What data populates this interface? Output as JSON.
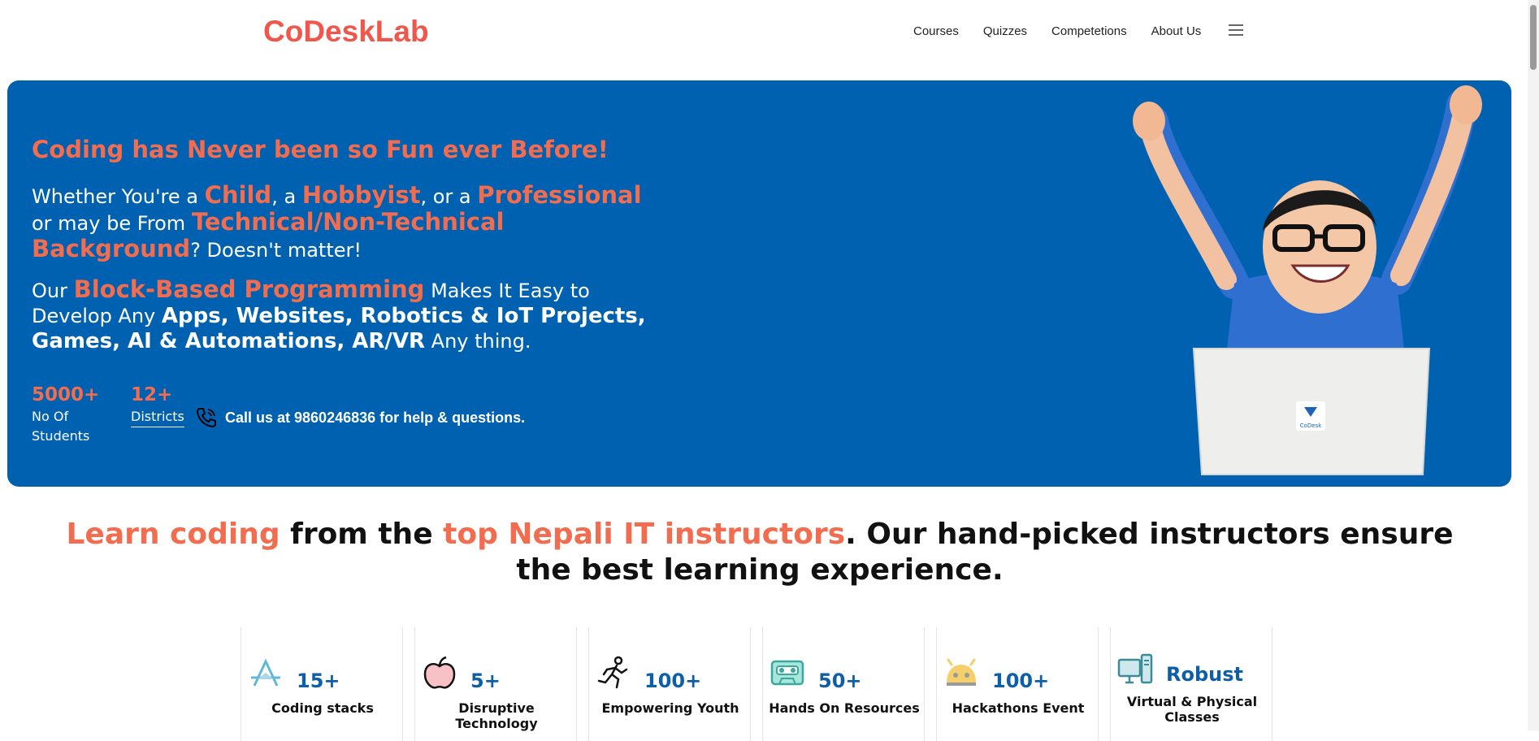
{
  "logo": "CoDeskLab",
  "nav": [
    "Courses",
    "Quizzes",
    "Competetions",
    "About Us"
  ],
  "hero": {
    "title": "Coding has Never been so Fun ever Before!",
    "p1": {
      "t1": "Whether You're a ",
      "h1": "Child",
      "t2": ", a ",
      "h2": "Hobbyist",
      "t3": ", or a ",
      "h3": "Professional",
      "t4": " or may be From ",
      "h4": "Technical/Non-Technical Background",
      "t5": "? Doesn't matter!"
    },
    "p2": {
      "t1": "Our ",
      "h1": "Block-Based Programming",
      "t2": " Makes It Easy to Develop Any ",
      "b1": "Apps, Websites, Robotics & IoT Projects, Games, AI & Automations, AR/VR",
      "t3": " Any thing."
    },
    "stats": [
      {
        "num": "5000+",
        "label_1": "No Of",
        "label_2": "Students"
      },
      {
        "num": "12+",
        "label_1": "Districts"
      }
    ],
    "call": "Call us at 9860246836 for help & questions.",
    "laptop_logo": "CoDesk"
  },
  "tagline": {
    "o1": "Learn coding",
    "t1": " from the ",
    "o2": "top Nepali IT instructors",
    "t2": ". Our hand-picked instructors ensure the best learning experience."
  },
  "features": [
    {
      "num": "15+",
      "label": "Coding stacks",
      "icon": "app-store-icon"
    },
    {
      "num": "5+",
      "label": "Disruptive Technology",
      "icon": "apple-icon"
    },
    {
      "num": "100+",
      "label": "Empowering Youth",
      "icon": "runner-icon"
    },
    {
      "num": "50+",
      "label": "Hands On Resources",
      "icon": "cassette-icon"
    },
    {
      "num": "100+",
      "label": "Hackathons Event",
      "icon": "android-icon"
    },
    {
      "num": "Robust",
      "label": "Virtual & Physical Classes",
      "icon": "desktop-icon"
    }
  ],
  "colors": {
    "brand": "#f0574a",
    "hero_bg": "#0061b1",
    "accent_number": "#0e5fa8"
  }
}
